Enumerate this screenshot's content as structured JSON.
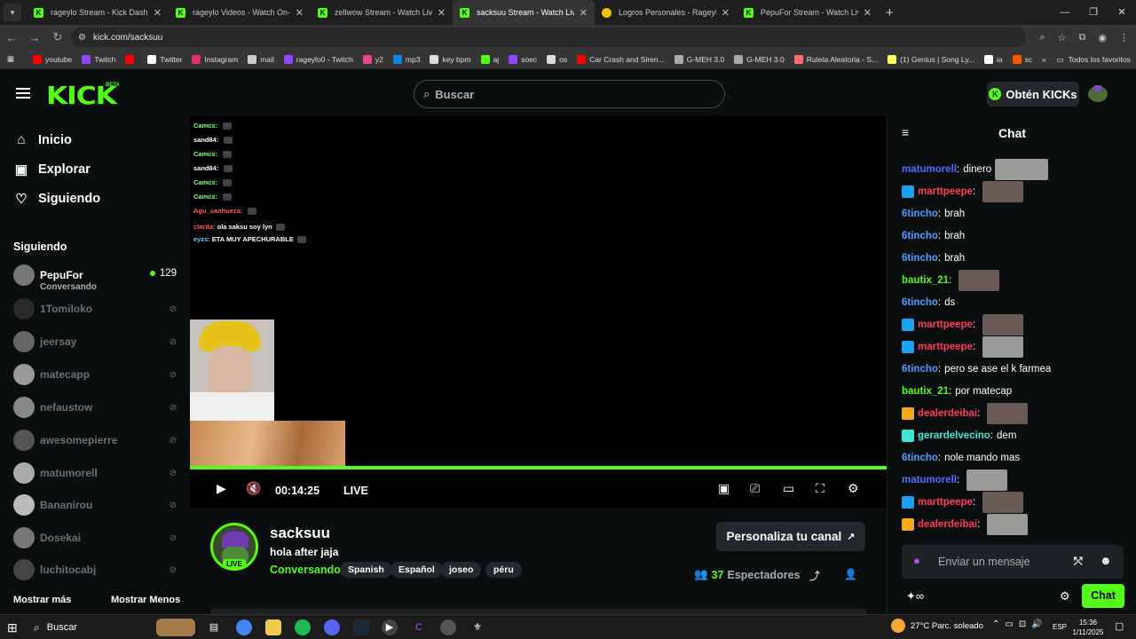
{
  "browser": {
    "tabs": [
      {
        "title": "rageylo Stream - Kick Dashboard",
        "active": false
      },
      {
        "title": "rageylo Videos - Watch On-Demand",
        "active": false
      },
      {
        "title": "zellwow Stream - Watch Live on Kick",
        "active": false
      },
      {
        "title": "sacksuu Stream - Watch Live on Kick",
        "active": true
      },
      {
        "title": "Logros Personales - Rageylo",
        "active": false
      },
      {
        "title": "PepuFor Stream - Watch Live on Kick",
        "active": false
      }
    ],
    "url": "kick.com/sacksuu",
    "bookmarks": [
      {
        "label": "youtube",
        "color": "#ff0000"
      },
      {
        "label": "Twitch",
        "color": "#9146ff"
      },
      {
        "label": "",
        "color": "#ff0000"
      },
      {
        "label": "Twitter",
        "color": "#ffffff"
      },
      {
        "label": "Instagram",
        "color": "#e1306c"
      },
      {
        "label": "mail",
        "color": "#cccccc"
      },
      {
        "label": "rageylo0 - Twitch",
        "color": "#9146ff"
      },
      {
        "label": "y2",
        "color": "#e84393"
      },
      {
        "label": "mp3",
        "color": "#0984e3"
      },
      {
        "label": "key bpm",
        "color": "#dddddd"
      },
      {
        "label": "aj",
        "color": "#53fc18"
      },
      {
        "label": "soec",
        "color": "#9146ff"
      },
      {
        "label": "os",
        "color": "#dddddd"
      },
      {
        "label": "Car Crash and Siren...",
        "color": "#ff0000"
      },
      {
        "label": "G-MEH 3.0",
        "color": "#aaaaaa"
      },
      {
        "label": "G-MEH 3.0",
        "color": "#aaaaaa"
      },
      {
        "label": "Ruleta Aleatoria - S...",
        "color": "#ff6b6b"
      },
      {
        "label": "(1) Genius | Song Ly...",
        "color": "#ffff64"
      },
      {
        "label": "ia",
        "color": "#ffffff"
      },
      {
        "label": "sc",
        "color": "#ff5500"
      }
    ],
    "bookmarks_all": "Todos los favoritos"
  },
  "header": {
    "logo": "KICK",
    "beta": "BETA",
    "search_placeholder": "Buscar",
    "kicks_button": "Obtén KICKs"
  },
  "sidebar": {
    "nav": [
      {
        "label": "Inicio",
        "icon": "home-icon"
      },
      {
        "label": "Explorar",
        "icon": "compass-icon"
      },
      {
        "label": "Siguiendo",
        "icon": "heart-icon"
      }
    ],
    "following_title": "Siguiendo",
    "following": [
      {
        "name": "PepuFor",
        "status": "Conversando",
        "viewers": "129",
        "live": true
      },
      {
        "name": "1Tomiloko",
        "live": false
      },
      {
        "name": "jeersay",
        "live": false
      },
      {
        "name": "matecapp",
        "live": false
      },
      {
        "name": "nefaustow",
        "live": false
      },
      {
        "name": "awesomepierre",
        "live": false
      },
      {
        "name": "matumorell",
        "live": false
      },
      {
        "name": "Bananirou",
        "live": false
      },
      {
        "name": "Dosekai",
        "live": false
      },
      {
        "name": "luchitocabj",
        "live": false
      }
    ],
    "show_more": "Mostrar más",
    "show_less": "Mostrar Menos"
  },
  "video": {
    "overlay_chat": [
      {
        "user": "Camcs:",
        "text": "",
        "color": "#7fff7f"
      },
      {
        "user": "sand84:",
        "text": "",
        "color": "#ffffff"
      },
      {
        "user": "Camcs:",
        "text": "",
        "color": "#7fff7f"
      },
      {
        "user": "sand84:",
        "text": "",
        "color": "#ffffff"
      },
      {
        "user": "Camcs:",
        "text": "",
        "color": "#7fff7f"
      },
      {
        "user": "Camcs:",
        "text": "",
        "color": "#7fff7f"
      },
      {
        "user": "Agu_sanhueza:",
        "text": "",
        "color": "#ff5e5e"
      },
      {
        "user": "clarita:",
        "text": "ola saksu soy lyn",
        "color": "#ff5e5e"
      },
      {
        "user": "eyzs:",
        "text": "ETA MUY APECHURABLE",
        "color": "#6ec2ff"
      }
    ],
    "timecode": "00:14:25",
    "live_label": "LIVE"
  },
  "stream": {
    "channel": "sacksuu",
    "title": "hola after jaja",
    "category": "Conversando",
    "tags": [
      "Spanish",
      "Español",
      "joseo",
      "péru"
    ],
    "live_badge": "LIVE",
    "personalize": "Personaliza tu canal",
    "viewers": "37",
    "viewers_label": "Espectadores"
  },
  "chat": {
    "title": "Chat",
    "messages": [
      {
        "user": "matumorell",
        "text": "dinero",
        "color": "#4a6fff",
        "badge": "",
        "image": true
      },
      {
        "user": "marttpeepe",
        "text": "",
        "color": "#ff3b5c",
        "badge": "#1da1f2",
        "image": true
      },
      {
        "user": "6tincho",
        "text": "brah",
        "color": "#4a9fff",
        "badge": "",
        "image": false
      },
      {
        "user": "6tincho",
        "text": "brah",
        "color": "#4a9fff",
        "badge": "",
        "image": false
      },
      {
        "user": "6tincho",
        "text": "brah",
        "color": "#4a9fff",
        "badge": "",
        "image": false
      },
      {
        "user": "bautix_21",
        "text": "",
        "color": "#53fc18",
        "badge": "",
        "image": true
      },
      {
        "user": "6tincho",
        "text": "ds",
        "color": "#4a9fff",
        "badge": "",
        "image": false
      },
      {
        "user": "marttpeepe",
        "text": "",
        "color": "#ff3b5c",
        "badge": "#1da1f2",
        "image": true
      },
      {
        "user": "marttpeepe",
        "text": "",
        "color": "#ff3b5c",
        "badge": "#1da1f2",
        "image": true
      },
      {
        "user": "6tincho",
        "text": "pero se ase el k farmea",
        "color": "#4a9fff",
        "badge": "",
        "image": false
      },
      {
        "user": "bautix_21",
        "text": "por matecap",
        "color": "#53fc18",
        "badge": "",
        "image": false
      },
      {
        "user": "dealerdeibai",
        "text": "",
        "color": "#ff3b5c",
        "badge": "#f5a623",
        "image": true
      },
      {
        "user": "gerardelvecino",
        "text": "dem",
        "color": "#3ee6d0",
        "badge": "#3ee6d0",
        "image": false
      },
      {
        "user": "6tincho",
        "text": "nole mando mas",
        "color": "#4a9fff",
        "badge": "",
        "image": false
      },
      {
        "user": "matumorell",
        "text": "",
        "color": "#4a6fff",
        "badge": "",
        "image": true
      },
      {
        "user": "marttpeepe",
        "text": "",
        "color": "#ff3b5c",
        "badge": "#1da1f2",
        "image": true
      },
      {
        "user": "dealerdeibai",
        "text": "",
        "color": "#ff3b5c",
        "badge": "#f5a623",
        "image": true
      }
    ],
    "input_placeholder": "Enviar un mensaje",
    "send_button": "Chat"
  },
  "taskbar": {
    "search": "Buscar",
    "weather": "27°C  Parc. soleado",
    "lang": "ESP",
    "time": "15:36",
    "date": "1/11/2025"
  },
  "colors": {
    "accent": "#53fc18",
    "background": "#0b0e0f"
  }
}
